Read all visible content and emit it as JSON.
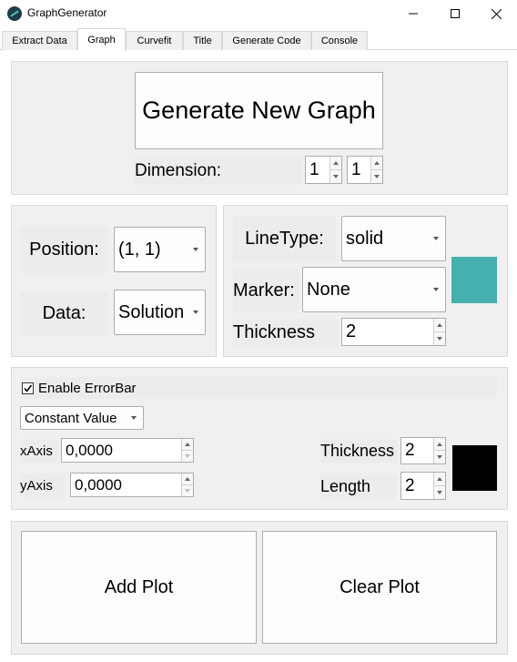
{
  "window": {
    "title": "GraphGenerator",
    "controls": {
      "minimize": "minimize-icon",
      "maximize": "maximize-icon",
      "close": "close-icon"
    }
  },
  "tabs": [
    {
      "label": "Extract Data"
    },
    {
      "label": "Graph",
      "active": true
    },
    {
      "label": "Curvefit"
    },
    {
      "label": "Title"
    },
    {
      "label": "Generate Code"
    },
    {
      "label": "Console"
    }
  ],
  "graph_panel": {
    "generate_button": "Generate New Graph",
    "dimension_label": "Dimension:",
    "dimension_rows": "1",
    "dimension_cols": "1"
  },
  "position_panel": {
    "position_label": "Position:",
    "position_value": "(1, 1)",
    "data_label": "Data:",
    "data_value": "Solution"
  },
  "line_panel": {
    "linetype_label": "LineType:",
    "linetype_value": "solid",
    "marker_label": "Marker:",
    "marker_value": "None",
    "thickness_label": "Thickness",
    "thickness_value": "2",
    "line_color": "#46b0b0"
  },
  "errorbar_panel": {
    "enable_label": "Enable ErrorBar",
    "enable_checked": true,
    "mode_value": "Constant Value",
    "xaxis_label": "xAxis",
    "xaxis_value": "0,0000",
    "yaxis_label": "yAxis",
    "yaxis_value": "0,0000",
    "thickness_label": "Thickness",
    "thickness_value": "2",
    "length_label": "Length",
    "length_value": "2",
    "bar_color": "#000000"
  },
  "actions": {
    "add_button": "Add Plot",
    "clear_button": "Clear Plot"
  }
}
